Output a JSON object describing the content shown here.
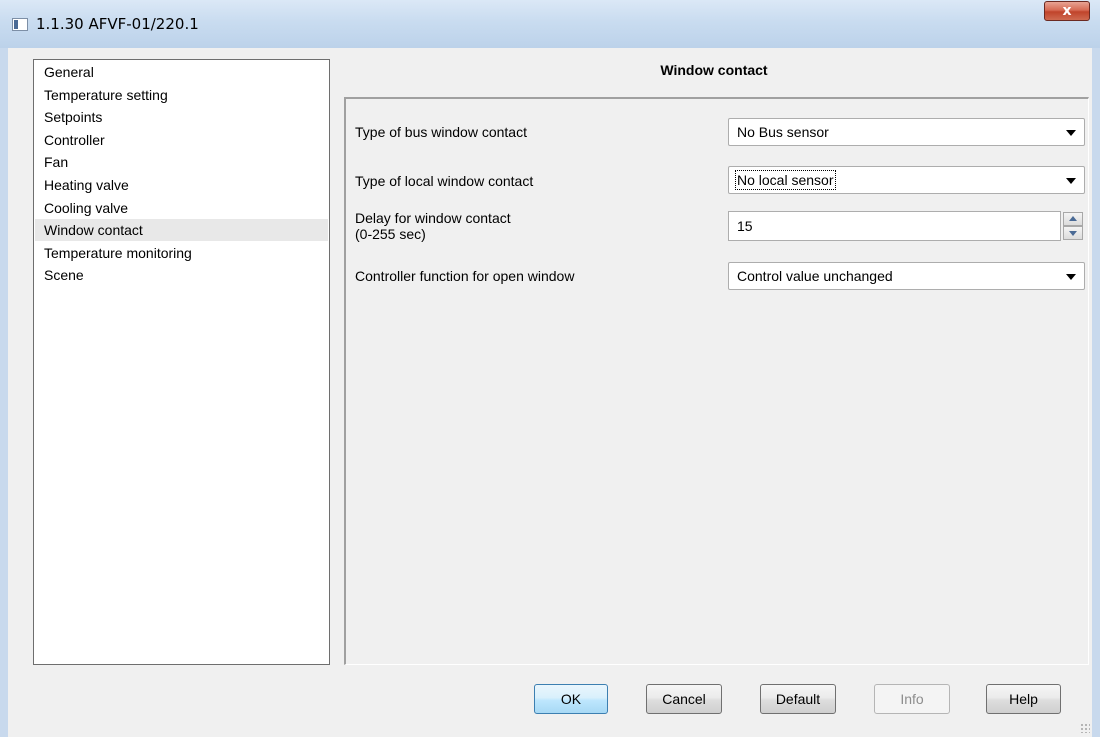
{
  "window": {
    "title": "1.1.30 AFVF-01/220.1",
    "close_glyph": "x"
  },
  "nav": {
    "items": [
      {
        "label": "General",
        "selected": false
      },
      {
        "label": "Temperature setting",
        "selected": false
      },
      {
        "label": "Setpoints",
        "selected": false
      },
      {
        "label": "Controller",
        "selected": false
      },
      {
        "label": "Fan",
        "selected": false
      },
      {
        "label": "Heating valve",
        "selected": false
      },
      {
        "label": "Cooling valve",
        "selected": false
      },
      {
        "label": "Window contact",
        "selected": true
      },
      {
        "label": "Temperature monitoring",
        "selected": false
      },
      {
        "label": "Scene",
        "selected": false
      }
    ]
  },
  "panel": {
    "title": "Window contact",
    "params": {
      "bus_contact": {
        "label": "Type of bus window contact",
        "value": "No Bus sensor"
      },
      "local_contact": {
        "label": "Type of local window contact",
        "value": "No local sensor"
      },
      "delay": {
        "label_line1": "Delay for window contact",
        "label_line2": "(0-255 sec)",
        "value": "15"
      },
      "open_window": {
        "label": "Controller function for open window",
        "value": "Control value unchanged"
      }
    }
  },
  "buttons": {
    "ok": "OK",
    "cancel": "Cancel",
    "default": "Default",
    "info": "Info",
    "help": "Help"
  }
}
